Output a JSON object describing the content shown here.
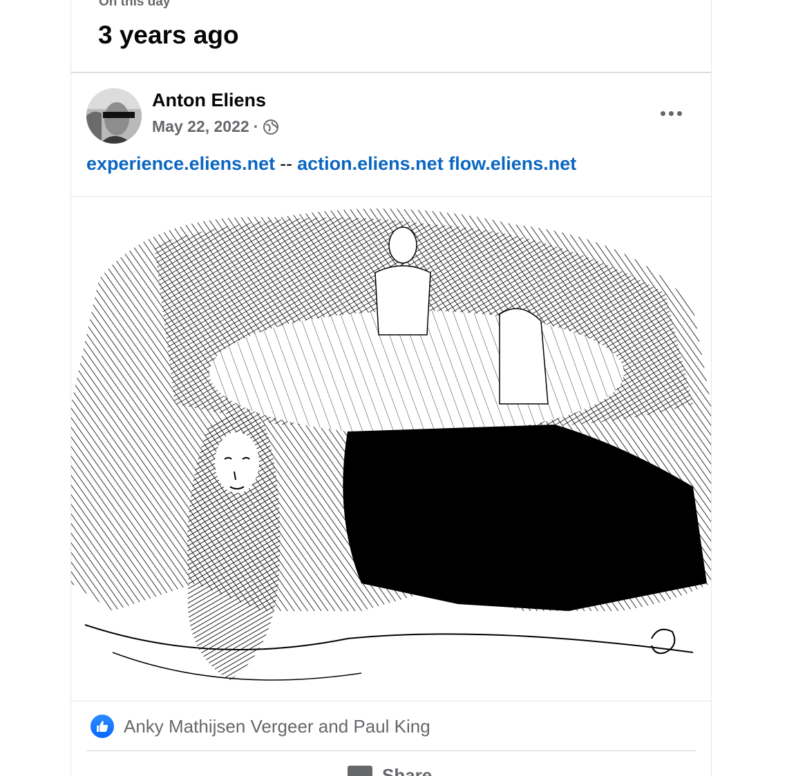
{
  "memory": {
    "eyebrow": "On this day",
    "title": "3 years ago"
  },
  "post": {
    "author": "Anton Eliens",
    "date": "May 22, 2022",
    "separator_dot": "·",
    "privacy_icon": "globe-icon",
    "links": {
      "link1": "experience.eliens.net",
      "sep": "--",
      "link2": "action.eliens.net",
      "link3": "flow.eliens.net"
    },
    "more_icon": "ellipsis-icon"
  },
  "reactions": {
    "icon": "like-icon",
    "names": "Anky Mathijsen Vergeer and Paul King"
  },
  "actions": {
    "share_label": "Share",
    "share_icon": "share-icon"
  },
  "colors": {
    "link": "#0a66c2",
    "like": "#0866ff",
    "secondary_text": "#65676b"
  }
}
